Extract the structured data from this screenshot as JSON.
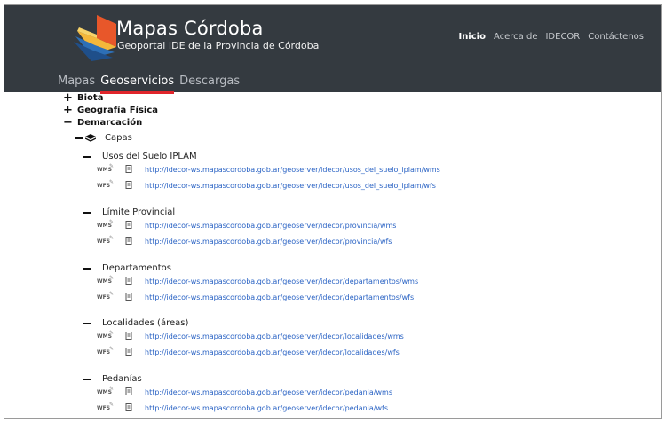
{
  "brand": {
    "title": "Mapas Córdoba",
    "subtitle": "Geoportal IDE de la Provincia de Córdoba"
  },
  "topnav": [
    "Inicio",
    "Acerca de",
    "IDECOR",
    "Contáctenos"
  ],
  "tabs": [
    "Mapas",
    "Geoservicios",
    "Descargas"
  ],
  "categories": [
    {
      "label": "Biota",
      "toggle": "+"
    },
    {
      "label": "Geografía Física",
      "toggle": "+"
    },
    {
      "label": "Demarcación",
      "toggle": "−"
    }
  ],
  "capas_label": "Capas",
  "layers": [
    {
      "name": "Usos del Suelo IPLAM",
      "wms": "http://idecor-ws.mapascordoba.gob.ar/geoserver/idecor/usos_del_suelo_iplam/wms",
      "wfs": "http://idecor-ws.mapascordoba.gob.ar/geoserver/idecor/usos_del_suelo_iplam/wfs"
    },
    {
      "name": "Límite Provincial",
      "wms": "http://idecor-ws.mapascordoba.gob.ar/geoserver/idecor/provincia/wms",
      "wfs": "http://idecor-ws.mapascordoba.gob.ar/geoserver/idecor/provincia/wfs"
    },
    {
      "name": "Departamentos",
      "wms": "http://idecor-ws.mapascordoba.gob.ar/geoserver/idecor/departamentos/wms",
      "wfs": "http://idecor-ws.mapascordoba.gob.ar/geoserver/idecor/departamentos/wfs"
    },
    {
      "name": "Localidades (áreas)",
      "wms": "http://idecor-ws.mapascordoba.gob.ar/geoserver/idecor/localidades/wms",
      "wfs": "http://idecor-ws.mapascordoba.gob.ar/geoserver/idecor/localidades/wfs"
    },
    {
      "name": "Pedanías",
      "wms": "http://idecor-ws.mapascordoba.gob.ar/geoserver/idecor/pedania/wms",
      "wfs": "http://idecor-ws.mapascordoba.gob.ar/geoserver/idecor/pedania/wfs"
    }
  ],
  "badges": {
    "wms": "WMS",
    "wfs": "WFS"
  },
  "colors": {
    "header_bg": "#343a40",
    "active_tab_underline": "#e0252b",
    "link": "#2a63c4"
  }
}
